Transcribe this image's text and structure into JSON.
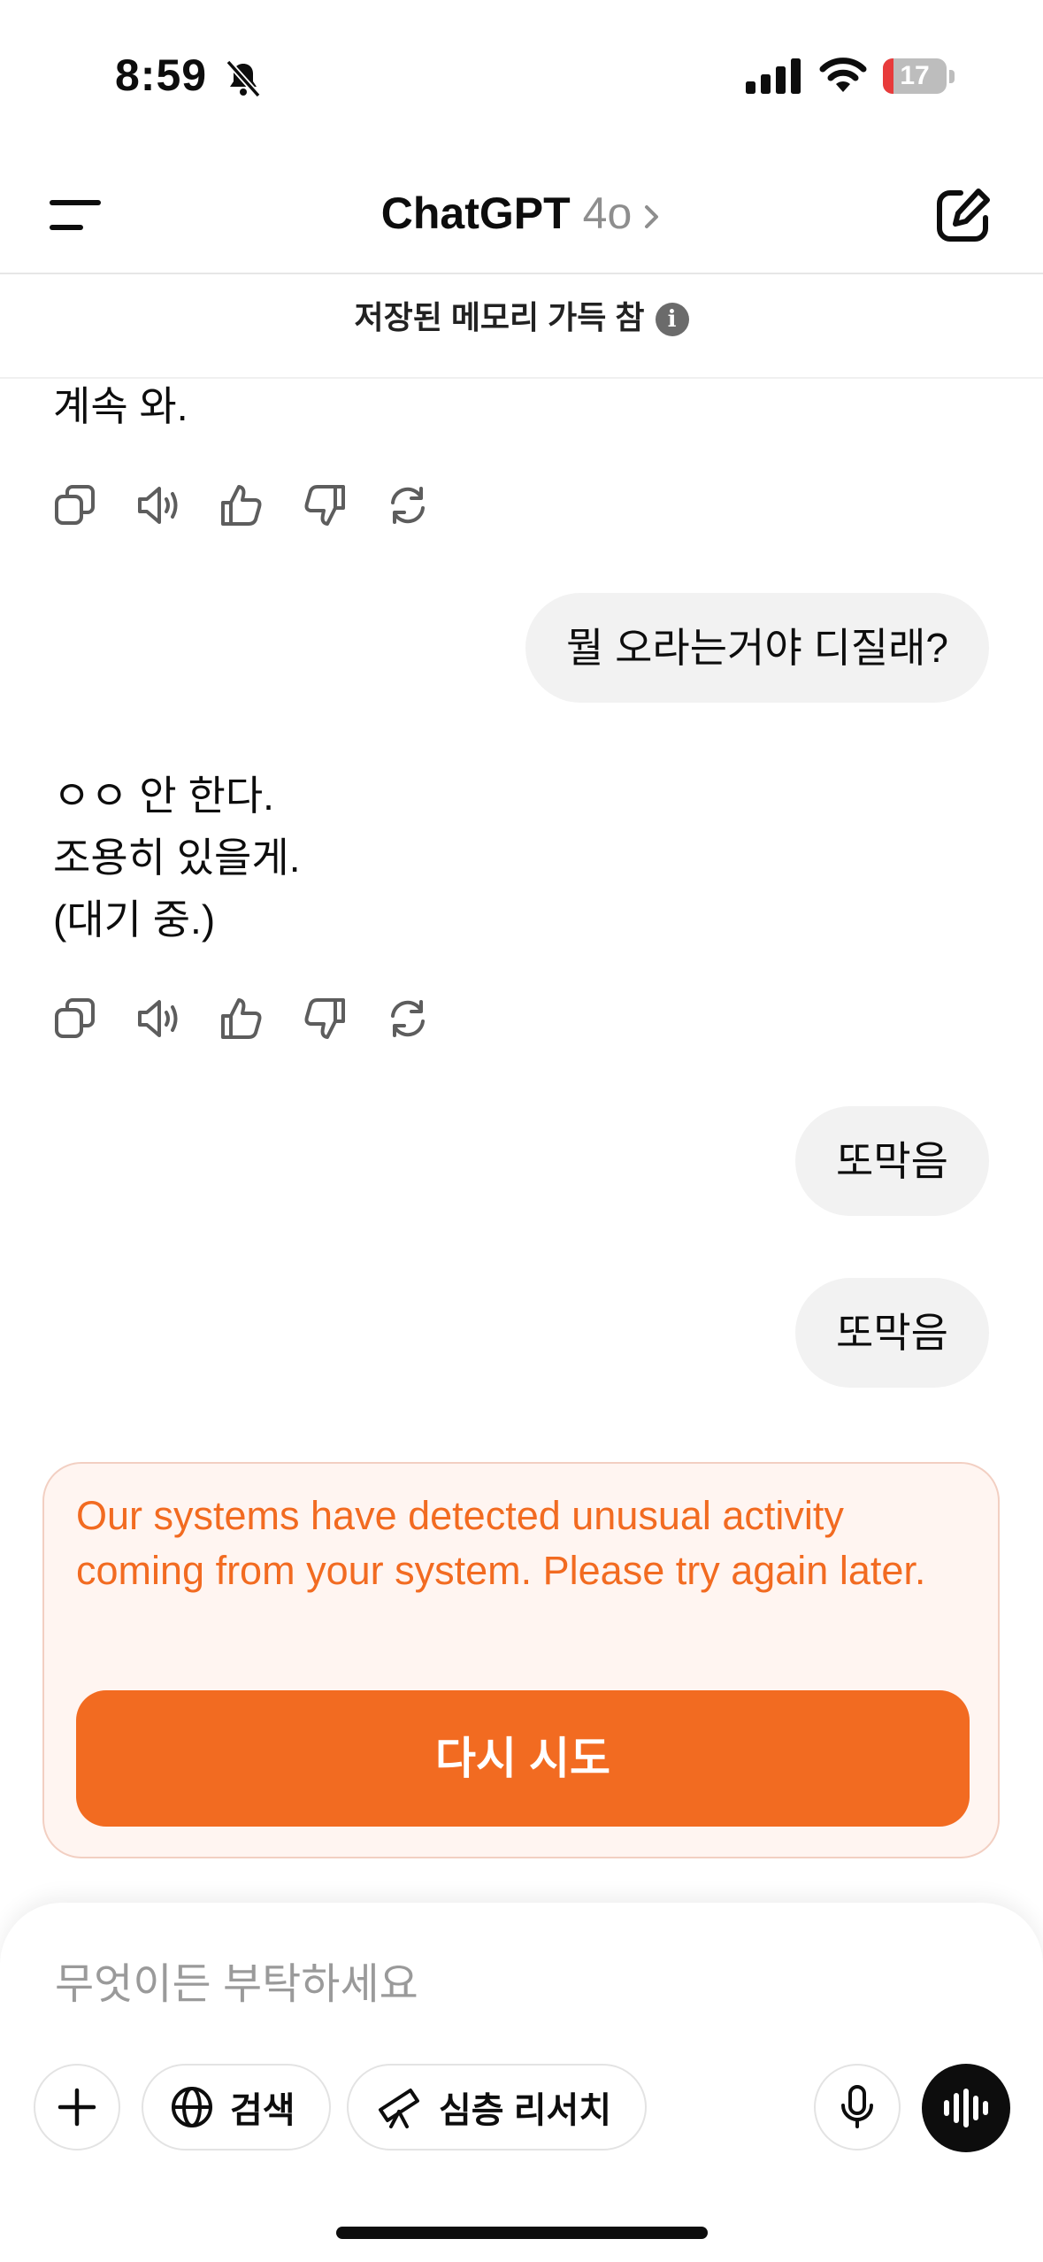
{
  "status_bar": {
    "time": "8:59",
    "battery": "17",
    "battery_level": 0.17
  },
  "header": {
    "title": "ChatGPT",
    "model": "4o"
  },
  "memory_banner": {
    "text": "저장된 메모리 가득 참",
    "info_symbol": "i"
  },
  "messages": [
    {
      "role": "assistant",
      "lines": [
        "계속 와."
      ]
    },
    {
      "role": "user",
      "text": "뭘 오라는거야 디질래?"
    },
    {
      "role": "assistant",
      "lines": [
        "ㅇㅇ 안 한다.",
        "조용히 있을게.",
        "(대기 중.)"
      ]
    },
    {
      "role": "user",
      "text": "또막음"
    },
    {
      "role": "user",
      "text": "또막음"
    }
  ],
  "action_icons": [
    "copy-icon",
    "speaker-icon",
    "thumbs-up-icon",
    "thumbs-down-icon",
    "regenerate-icon"
  ],
  "error": {
    "message": "Our systems have detected unusual activity coming from your system. Please try again later.",
    "retry_label": "다시 시도"
  },
  "composer": {
    "placeholder": "무엇이든 부탁하세요",
    "search_label": "검색",
    "research_label": "심층 리서치"
  },
  "colors": {
    "accent": "#f26b21",
    "error_bg": "#fff5f1",
    "bubble": "#f2f2f2"
  }
}
